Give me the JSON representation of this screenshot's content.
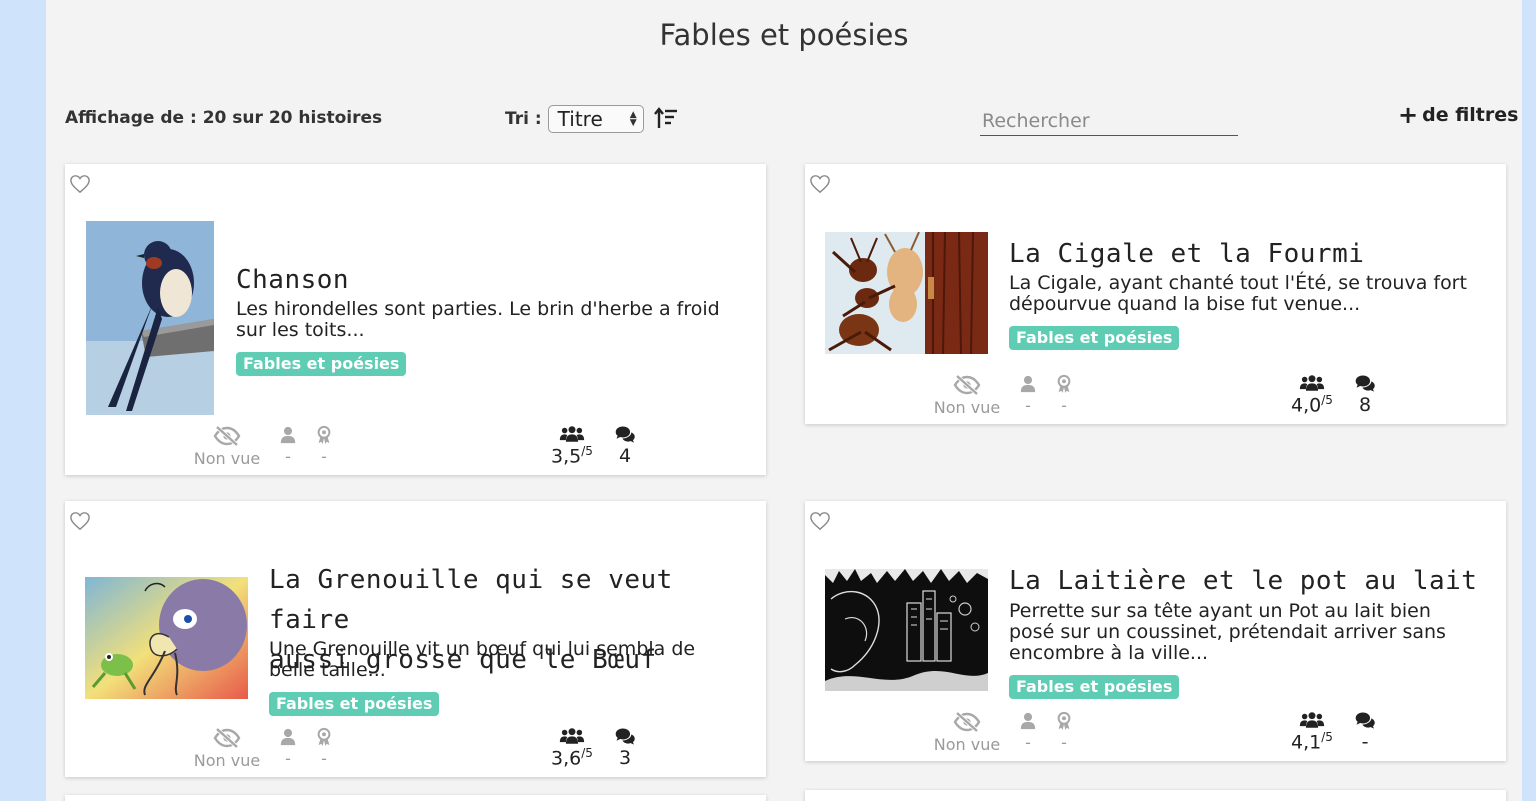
{
  "page": {
    "title": "Fables et poésies"
  },
  "toolbar": {
    "count_label": "Affichage de : 20 sur 20 histoires",
    "sort_label": "Tri :",
    "sort_value": "Titre",
    "search_placeholder": "Rechercher",
    "filters_plus": "+",
    "filters_label": "de filtres"
  },
  "cards": [
    {
      "title_line1": "Chanson",
      "title_line2": "",
      "excerpt_line1": "Les hirondelles sont parties. Le brin d'herbe a froid",
      "excerpt_line2": "sur les toits...",
      "excerpt_line3": "",
      "tag": "Fables et poésies",
      "status": "Non vue",
      "author": "-",
      "award": "-",
      "rating": "3,5",
      "rating_max": "/5",
      "comments": "4",
      "thumbnail": "swallow"
    },
    {
      "title_line1": "La Cigale et la Fourmi",
      "title_line2": "",
      "excerpt_line1": "La Cigale, ayant chanté tout l'Été, se trouva fort",
      "excerpt_line2": "dépourvue quand la bise fut venue...",
      "excerpt_line3": "",
      "tag": "Fables et poésies",
      "status": "Non vue",
      "author": "-",
      "award": "-",
      "rating": "4,0",
      "rating_max": "/5",
      "comments": "8",
      "thumbnail": "ant-and-cicada"
    },
    {
      "title_line1": "La Grenouille qui se veut faire",
      "title_line2": "aussi grosse que le Bœuf",
      "excerpt_line1": "Une Grenouille vit un bœuf qui lui sembla de",
      "excerpt_line2": "belle taille...",
      "excerpt_line3": "",
      "tag": "Fables et poésies",
      "status": "Non vue",
      "author": "-",
      "award": "-",
      "rating": "3,6",
      "rating_max": "/5",
      "comments": "3",
      "thumbnail": "frog-and-ox"
    },
    {
      "title_line1": "La Laitière et le pot au lait",
      "title_line2": "",
      "excerpt_line1": "Perrette sur sa tête ayant un Pot au lait bien",
      "excerpt_line2": "posé sur un coussinet, prétendait arriver sans",
      "excerpt_line3": "encombre à la ville...",
      "tag": "Fables et poésies",
      "status": "Non vue",
      "author": "-",
      "award": "-",
      "rating": "4,1",
      "rating_max": "/5",
      "comments": "-",
      "thumbnail": "milkmaid"
    }
  ],
  "colors": {
    "tag_bg": "#5fcdb3",
    "page_bg": "#f3f3f3",
    "side_bg": "#cfe3fb",
    "muted": "#9a9a9a"
  },
  "icons": [
    "heart-icon",
    "eye-slash-icon",
    "user-icon",
    "award-icon",
    "users-icon",
    "comments-icon",
    "sort-descending-icon"
  ]
}
